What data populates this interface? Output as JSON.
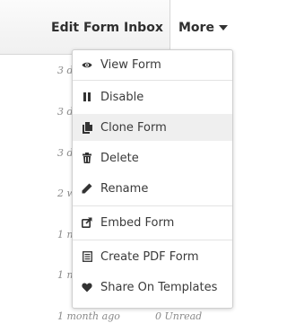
{
  "nav": {
    "edit_form": "Edit Form",
    "inbox": "Inbox",
    "more": "More"
  },
  "background_rows": [
    {
      "date": "3 d"
    },
    {
      "date": "3 d"
    },
    {
      "date": "3 d"
    },
    {
      "date": "2 w"
    },
    {
      "date": "1 m"
    },
    {
      "date": "1 m"
    },
    {
      "date": "1 month ago",
      "unread": "0 Unread"
    }
  ],
  "menu": {
    "items": [
      {
        "label": "View Form",
        "icon": "eye-icon"
      },
      {
        "label": "Disable",
        "icon": "pause-icon"
      },
      {
        "label": "Clone Form",
        "icon": "copy-icon",
        "active": true
      },
      {
        "label": "Delete",
        "icon": "trash-icon"
      },
      {
        "label": "Rename",
        "icon": "pencil-icon"
      },
      {
        "label": "Embed Form",
        "icon": "embed-icon"
      },
      {
        "label": "Create PDF Form",
        "icon": "pdf-document-icon"
      },
      {
        "label": "Share On Templates",
        "icon": "heart-icon"
      }
    ]
  },
  "colors": {
    "highlight": "#efefef",
    "text": "#3a3a3a",
    "icon": "#333333"
  }
}
